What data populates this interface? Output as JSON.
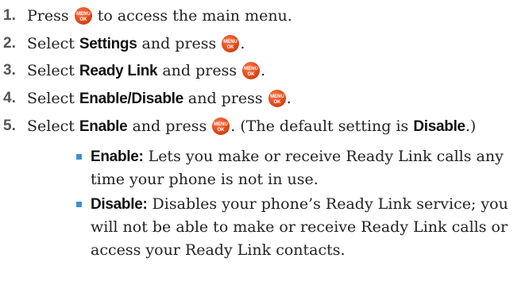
{
  "steps": [
    {
      "number": "1.",
      "before": "Press ",
      "key_icon": "menu-ok-key",
      "after": " to access the main menu."
    },
    {
      "number": "2.",
      "before": "Select ",
      "keyword": "Settings",
      "middle": " and press ",
      "key_icon": "menu-ok-key",
      "after": "."
    },
    {
      "number": "3.",
      "before": "Select ",
      "keyword": "Ready Link",
      "middle": " and press ",
      "key_icon": "menu-ok-key",
      "after": "."
    },
    {
      "number": "4.",
      "before": "Select ",
      "keyword": "Enable/Disable",
      "middle": " and press ",
      "key_icon": "menu-ok-key",
      "after": "."
    },
    {
      "number": "5.",
      "before": "Select ",
      "keyword": "Enable",
      "middle": " and press ",
      "key_icon": "menu-ok-key",
      "after": ". (The default setting is ",
      "keyword2": "Disable",
      "after2": ".)"
    }
  ],
  "bullets": [
    {
      "term": "Enable:",
      "text": " Lets you make or receive Ready Link calls any time your phone is not in use."
    },
    {
      "term": "Disable:",
      "text": " Disables your phone’s Ready Link service; you will not be able to make or receive Ready Link calls or access your Ready Link contacts."
    }
  ],
  "key_label_top": "MENU",
  "key_label_bottom": "OK",
  "colors": {
    "key": "#e04a1a",
    "bullet": "#3b8fd6",
    "number": "#555555"
  }
}
